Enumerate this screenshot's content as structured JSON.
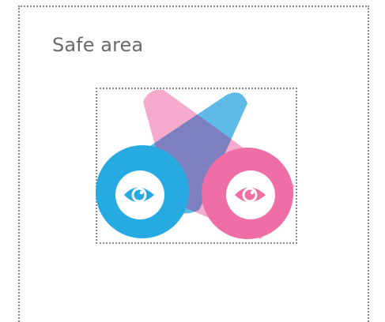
{
  "title": "Safe area",
  "colors": {
    "frame": "#8a8a8a",
    "title": "#6a6a6a",
    "blue": "#27aae1",
    "pink": "#ee6ea5",
    "overlap": "#7e7fbf"
  },
  "logo": {
    "icons": [
      "left-eye-icon",
      "right-eye-icon"
    ]
  }
}
